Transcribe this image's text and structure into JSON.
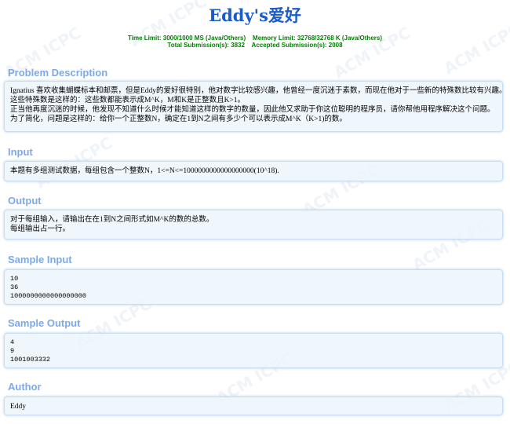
{
  "problem": {
    "title": "Eddy's爱好",
    "limits_line1": "Time Limit: 3000/1000 MS (Java/Others)    Memory Limit: 32768/32768 K (Java/Others)",
    "limits_line2": "Total Submission(s): 3832    Accepted Submission(s): 2008"
  },
  "watermark": {
    "texts": [
      "ACM ICPC",
      "ACM ICPC",
      "ACM ICPC",
      "ACM ICPC",
      "ACM ICPC",
      "ACM ICPC",
      "ACM ICPC",
      "ACM ICPC",
      "ACM ICPC",
      "ACM ICPC"
    ]
  },
  "sections": {
    "description": {
      "heading": "Problem Description",
      "lines": [
        "Ignatius 喜欢收集蝴蝶标本和邮票，但是Eddy的爱好很特别，他对数字比较感兴趣，他曾经一度沉迷于素数，而现在他对于一些新的特殊数比较有兴趣。",
        "这些特殊数是这样的：这些数都能表示成M^K，M和K是正整数且K>1。",
        "正当他再度沉迷的时候，他发现不知道什么时候才能知道这样的数字的数量，因此他又求助于你这位聪明的程序员，请你帮他用程序解决这个问题。",
        "为了简化，问题是这样的：给你一个正整数N，确定在1到N之间有多少个可以表示成M^K（K>1)的数。"
      ]
    },
    "input": {
      "heading": "Input",
      "lines": [
        "本题有多组测试数据，每组包含一个整数N，1<=N<=1000000000000000000(10^18)."
      ]
    },
    "output": {
      "heading": "Output",
      "lines": [
        "对于每组输入，请输出在在1到N之间形式如M^K的数的总数。",
        "每组输出占一行。"
      ]
    },
    "sample_input": {
      "heading": "Sample Input",
      "lines": [
        "10",
        "36",
        "1000000000000000000"
      ]
    },
    "sample_output": {
      "heading": "Sample Output",
      "lines": [
        "4",
        "9",
        "1001003332"
      ]
    },
    "author": {
      "heading": "Author",
      "lines": [
        "Eddy"
      ]
    }
  }
}
